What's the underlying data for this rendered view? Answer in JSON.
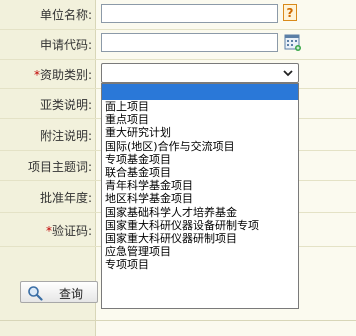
{
  "form": {
    "unit_name_label": "单位名称:",
    "apply_code_label": "申请代码:",
    "funding_type_label": "资助类别:",
    "funding_type_required": "*",
    "subtype_label": "亚类说明:",
    "note_label": "附注说明:",
    "keyword_label": "项目主题词:",
    "year_label": "批准年度:",
    "captcha_label": "验证码:",
    "captcha_required": "*",
    "unit_name_value": "",
    "apply_code_value": "",
    "funding_type_value": ""
  },
  "dropdown": {
    "options": [
      "面上项目",
      "重点项目",
      "重大研究计划",
      "国际(地区)合作与交流项目",
      "专项基金项目",
      "联合基金项目",
      "青年科学基金项目",
      "地区科学基金项目",
      "国家基础科学人才培养基金",
      "国家重大科研仪器设备研制专项",
      "国家重大科研仪器研制项目",
      "应急管理项目",
      "专项项目"
    ]
  },
  "actions": {
    "query_label": "查询"
  },
  "colors": {
    "page_bg": "#fbfaef",
    "label_bg": "#f2f1dc",
    "selected_option": "#2a78d8",
    "required_mark": "#c00000"
  },
  "icons": {
    "help": "help-icon",
    "calculator": "calculator-icon",
    "chevron": "chevron-down-icon",
    "search": "search-icon"
  }
}
